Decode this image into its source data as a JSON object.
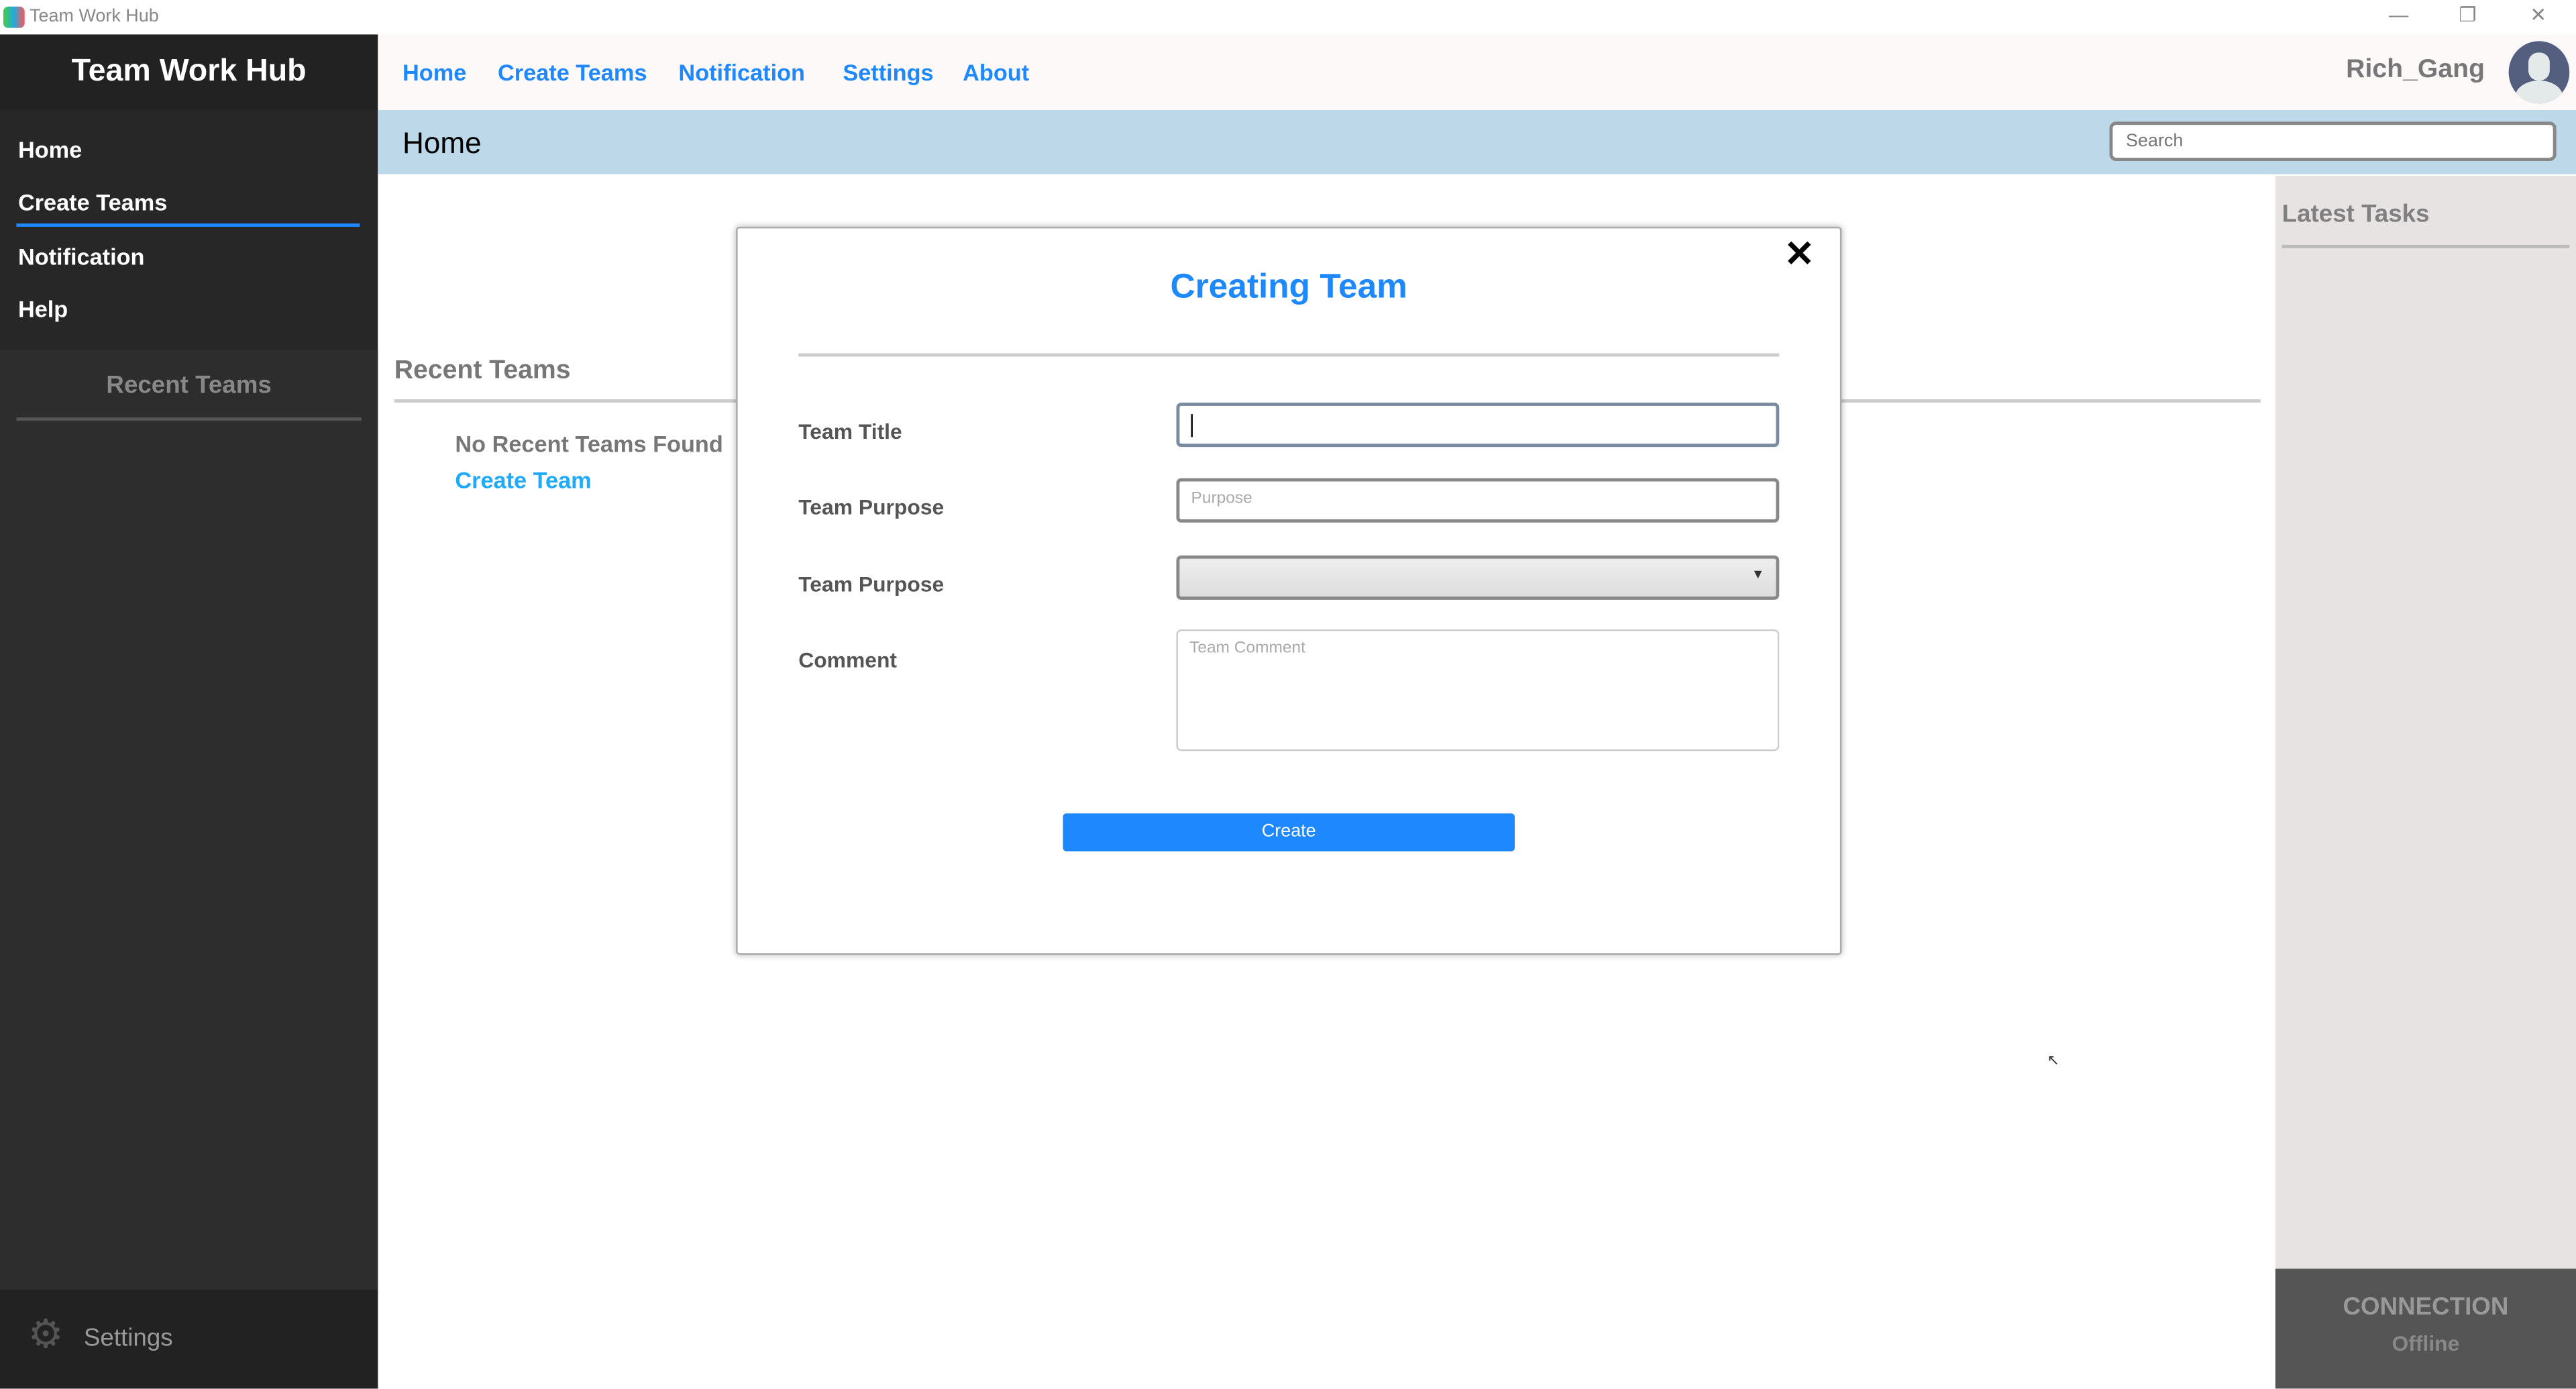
{
  "window": {
    "title": "Team Work Hub",
    "controls": [
      "minimize",
      "restore",
      "close"
    ]
  },
  "sidebar": {
    "brand": "Team Work Hub",
    "items": [
      {
        "label": "Home"
      },
      {
        "label": "Create Teams",
        "active": true
      },
      {
        "label": "Notification"
      },
      {
        "label": "Help"
      }
    ],
    "recent_title": "Recent Teams",
    "settings_label": "Settings"
  },
  "topnav": {
    "items": [
      "Home",
      "Create Teams",
      "Notification",
      "Settings",
      "About"
    ],
    "username": "Rich_Gang"
  },
  "header": {
    "title": "Home",
    "search_placeholder": "Search"
  },
  "main": {
    "recent_title": "Recent Teams",
    "empty_text": "No Recent Teams Found",
    "create_link": "Create Team"
  },
  "right": {
    "title": "Latest Tasks",
    "connection_label": "CONNECTION",
    "connection_status": "Offline"
  },
  "modal": {
    "title": "Creating Team",
    "fields": [
      {
        "label": "Team Title",
        "value": ""
      },
      {
        "label": "Team Purpose",
        "placeholder": "Purpose"
      },
      {
        "label": "Team Purpose",
        "selected": ""
      },
      {
        "label": "Comment",
        "placeholder": "Team Comment"
      }
    ],
    "create_label": "Create"
  },
  "colors": {
    "accent": "#1e88ff",
    "sidebar": "#272727",
    "header": "#bcd8e9"
  }
}
